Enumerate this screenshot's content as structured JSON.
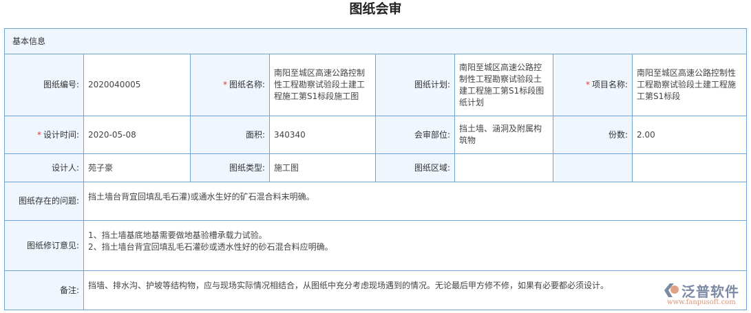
{
  "title": "图纸会审",
  "section": "基本信息",
  "fields": {
    "drawing_no": {
      "label": "图纸编号:",
      "value": "2020040005"
    },
    "drawing_name": {
      "label": "图纸名称:",
      "value": "南阳至城区高速公路控制性工程勘察试验段土建工程施工第S1标段施工图",
      "required": true
    },
    "drawing_plan": {
      "label": "图纸计划:",
      "value": "南阳至城区高速公路控制性工程勘察试验段土建工程施工第S1标段图纸计划"
    },
    "project_name": {
      "label": "项目名称:",
      "value": "南阳至城区高速公路控制性工程勘察试验段土建工程施工第S1标段",
      "required": true
    },
    "design_time": {
      "label": "设计时间:",
      "value": "2020-05-08",
      "required": true
    },
    "area": {
      "label": "面积:",
      "value": "340340"
    },
    "review_part": {
      "label": "会审部位:",
      "value": "挡土墙、涵洞及附属构筑物"
    },
    "copies": {
      "label": "份数:",
      "value": "2.00"
    },
    "designer": {
      "label": "设计人:",
      "value": "苑子豪"
    },
    "drawing_type": {
      "label": "图纸类型:",
      "value": "施工图"
    },
    "drawing_area": {
      "label": "图纸区域:",
      "value": ""
    },
    "problems": {
      "label": "图纸存在的问题:",
      "value": "挡土墙台背宜回填乱毛石灌)或通水生好的矿石混合料末明确。"
    },
    "revision": {
      "label": "图纸修订意见:",
      "lines": [
        "1、挡土墙基底地基需要做地基验槽承载力试验。",
        "2、挡土墙台背宜回填乱毛石灌砂或透水性好的砂石混合料应明确。"
      ]
    },
    "remark": {
      "label": "备注:",
      "value": "挡墙、排水沟、护坡等结构物，应与现场实际情况相结合，从图纸中充分考虑现场遇到的情况。无论最后甲方修不修，如果有必要都必须设计。"
    }
  },
  "required_mark": "*",
  "watermark": {
    "name": "泛普软件",
    "url": "www.fanpusoft.com"
  }
}
